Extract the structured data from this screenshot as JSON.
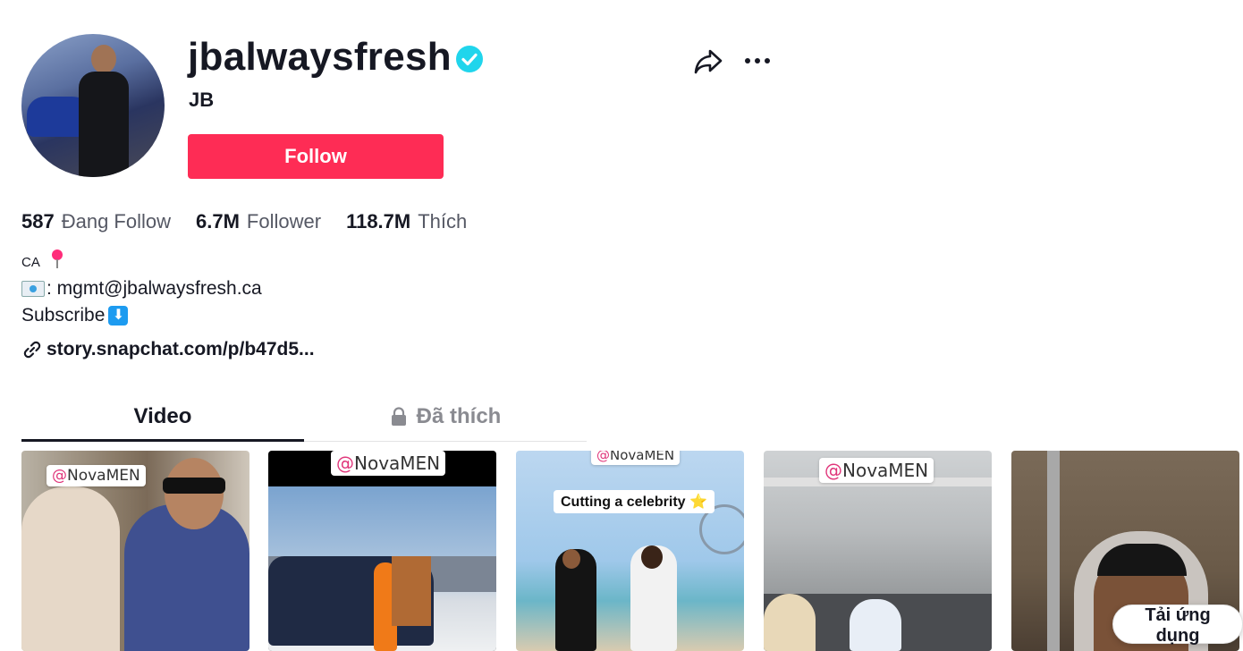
{
  "profile": {
    "username": "jbalwaysfresh",
    "nickname": "JB",
    "verified": true,
    "follow_label": "Follow",
    "follow_color": "#fe2c55"
  },
  "actions": {
    "share_icon": "share-icon",
    "more_icon": "more-icon"
  },
  "stats": [
    {
      "num": "587",
      "label": "Đang Follow"
    },
    {
      "num": "6.7M",
      "label": "Follower"
    },
    {
      "num": "118.7M",
      "label": "Thích"
    }
  ],
  "bio": {
    "location": "CA",
    "email_line": ": mgmt@jbalwaysfresh.ca",
    "subscribe": "Subscribe"
  },
  "link": "story.snapchat.com/p/b47d5...",
  "tabs": [
    {
      "label": "Video",
      "active": true
    },
    {
      "label": "Đã thích",
      "active": false,
      "locked": true
    }
  ],
  "videos": [
    {
      "tag_at": "@",
      "tag_text": "NovaMEN"
    },
    {
      "tag_at": "@",
      "tag_text": "NovaMEN"
    },
    {
      "tag_at": "@",
      "tag_text": "NovaMEN",
      "caption": "Cutting a celebrity ⭐"
    },
    {
      "tag_at": "@",
      "tag_text": "NovaMEN"
    },
    {}
  ],
  "app_button": "Tải ứng dụng"
}
